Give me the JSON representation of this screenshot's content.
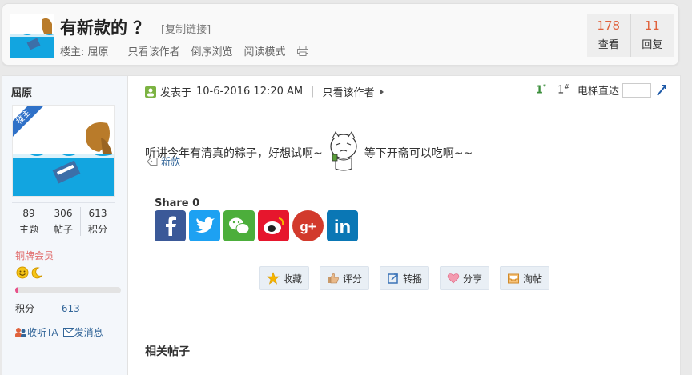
{
  "header": {
    "title": "有新款的 ？",
    "copy_link": "[复制链接]",
    "author_label": "楼主: 屈原",
    "only_author": "只看该作者",
    "reverse_order": "倒序浏览",
    "read_mode": "阅读模式",
    "stats": [
      {
        "value": "178",
        "label": "查看"
      },
      {
        "value": "11",
        "label": "回复"
      }
    ]
  },
  "sidebar": {
    "author": "屈原",
    "badge": "楼主",
    "stats": [
      {
        "value": "89",
        "label": "主题"
      },
      {
        "value": "306",
        "label": "帖子"
      },
      {
        "value": "613",
        "label": "积分"
      }
    ],
    "rank": "铜牌会员",
    "progress_fraction": 0.02,
    "score_label": "积分",
    "score_value": "613",
    "follow": "收听TA",
    "message": "发消息"
  },
  "post": {
    "posted_prefix": "发表于",
    "posted_time": "10-6-2016 12:20 AM",
    "only_author": "只看该作者",
    "floor_first": "1",
    "floor_first_mark": "*",
    "floor_num": "1",
    "floor_num_mark": "#",
    "elevator": "电梯直达",
    "message_before": "听讲今年有清真的粽子，好想试啊~",
    "message_after": "等下开斋可以吃啊~~",
    "tag": "新款",
    "share_title": "Share 0",
    "share_buttons": [
      "facebook-icon",
      "twitter-icon",
      "wechat-icon",
      "weibo-icon",
      "google-plus-icon",
      "linkedin-icon"
    ],
    "actions": [
      "收藏",
      "评分",
      "转播",
      "分享",
      "淘帖"
    ],
    "related_title": "相关帖子"
  },
  "colors": {
    "stat_number": "#e0623c",
    "link": "#336699",
    "rank": "#e06a6a",
    "floor_first": "#3c8f3c",
    "badge": "#2f71c8"
  }
}
